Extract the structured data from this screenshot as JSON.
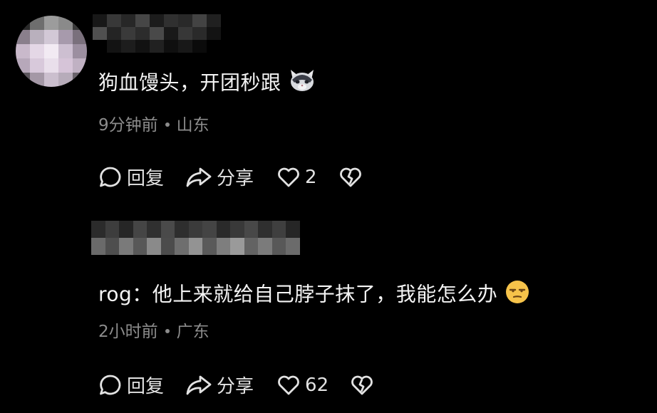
{
  "comments": [
    {
      "text": "狗血馒头，开团秒跟",
      "emoji": "cat-face-emoji",
      "time": "9分钟前",
      "location": "山东",
      "reply_label": "回复",
      "share_label": "分享",
      "like_count": "2"
    },
    {
      "text": "rog：他上来就给自己脖子抹了，我能怎么办",
      "emoji": "unamused-face-emoji",
      "time": "2小时前",
      "location": "广东",
      "reply_label": "回复",
      "share_label": "分享",
      "like_count": "62"
    }
  ],
  "colors": {
    "background": "#000000",
    "text": "#f4f4f4",
    "meta": "#8c8c8c",
    "icon": "#e2e2e2"
  }
}
